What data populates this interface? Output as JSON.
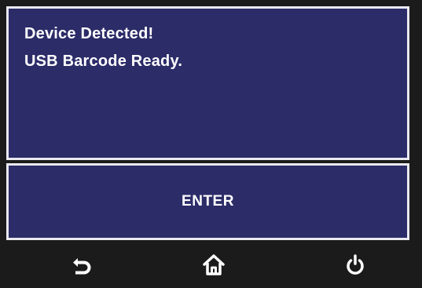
{
  "message": {
    "line1": "Device Detected!",
    "line2": "USB Barcode Ready."
  },
  "enter_button": {
    "label": "ENTER"
  },
  "nav": {
    "back_icon": "back-arrow-icon",
    "home_icon": "home-icon",
    "power_icon": "power-icon"
  },
  "colors": {
    "panel_bg": "#2c2c69",
    "panel_border": "#e9e9f0",
    "nav_bg": "#1b1b1b",
    "text": "#ffffff"
  }
}
